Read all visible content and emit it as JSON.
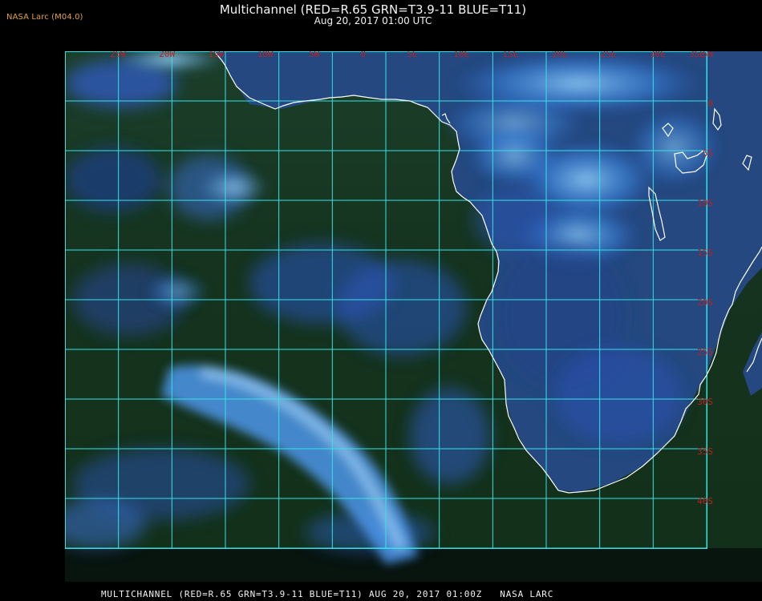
{
  "header": {
    "badge": "NASA Larc (M04.0)",
    "title": "Multichannel (RED=R.65 GRN=T3.9-11 BLUE=T11)",
    "subtitle": "Aug 20, 2017 01:00 UTC"
  },
  "map": {
    "lon_labels": [
      "25W",
      "20W",
      "15W",
      "10W",
      "5W",
      "0",
      "5E",
      "10E",
      "15E",
      "20E",
      "25E",
      "30E",
      "35E"
    ],
    "lat_labels": [
      "5N",
      "0",
      "5S",
      "10S",
      "15S",
      "20S",
      "25S",
      "30S",
      "35S",
      "40S"
    ],
    "colors": {
      "ocean": "#16361f",
      "land": "#23467d",
      "grid": "#34e3e8",
      "coast": "#ffffff",
      "label": "#c02020",
      "cloud": "#3d8be8",
      "cloud_light": "#8bc5f0"
    }
  },
  "footer": {
    "text": "MULTICHANNEL (RED=R.65 GRN=T3.9-11 BLUE=T11) AUG 20, 2017 01:00Z   NASA LARC"
  }
}
